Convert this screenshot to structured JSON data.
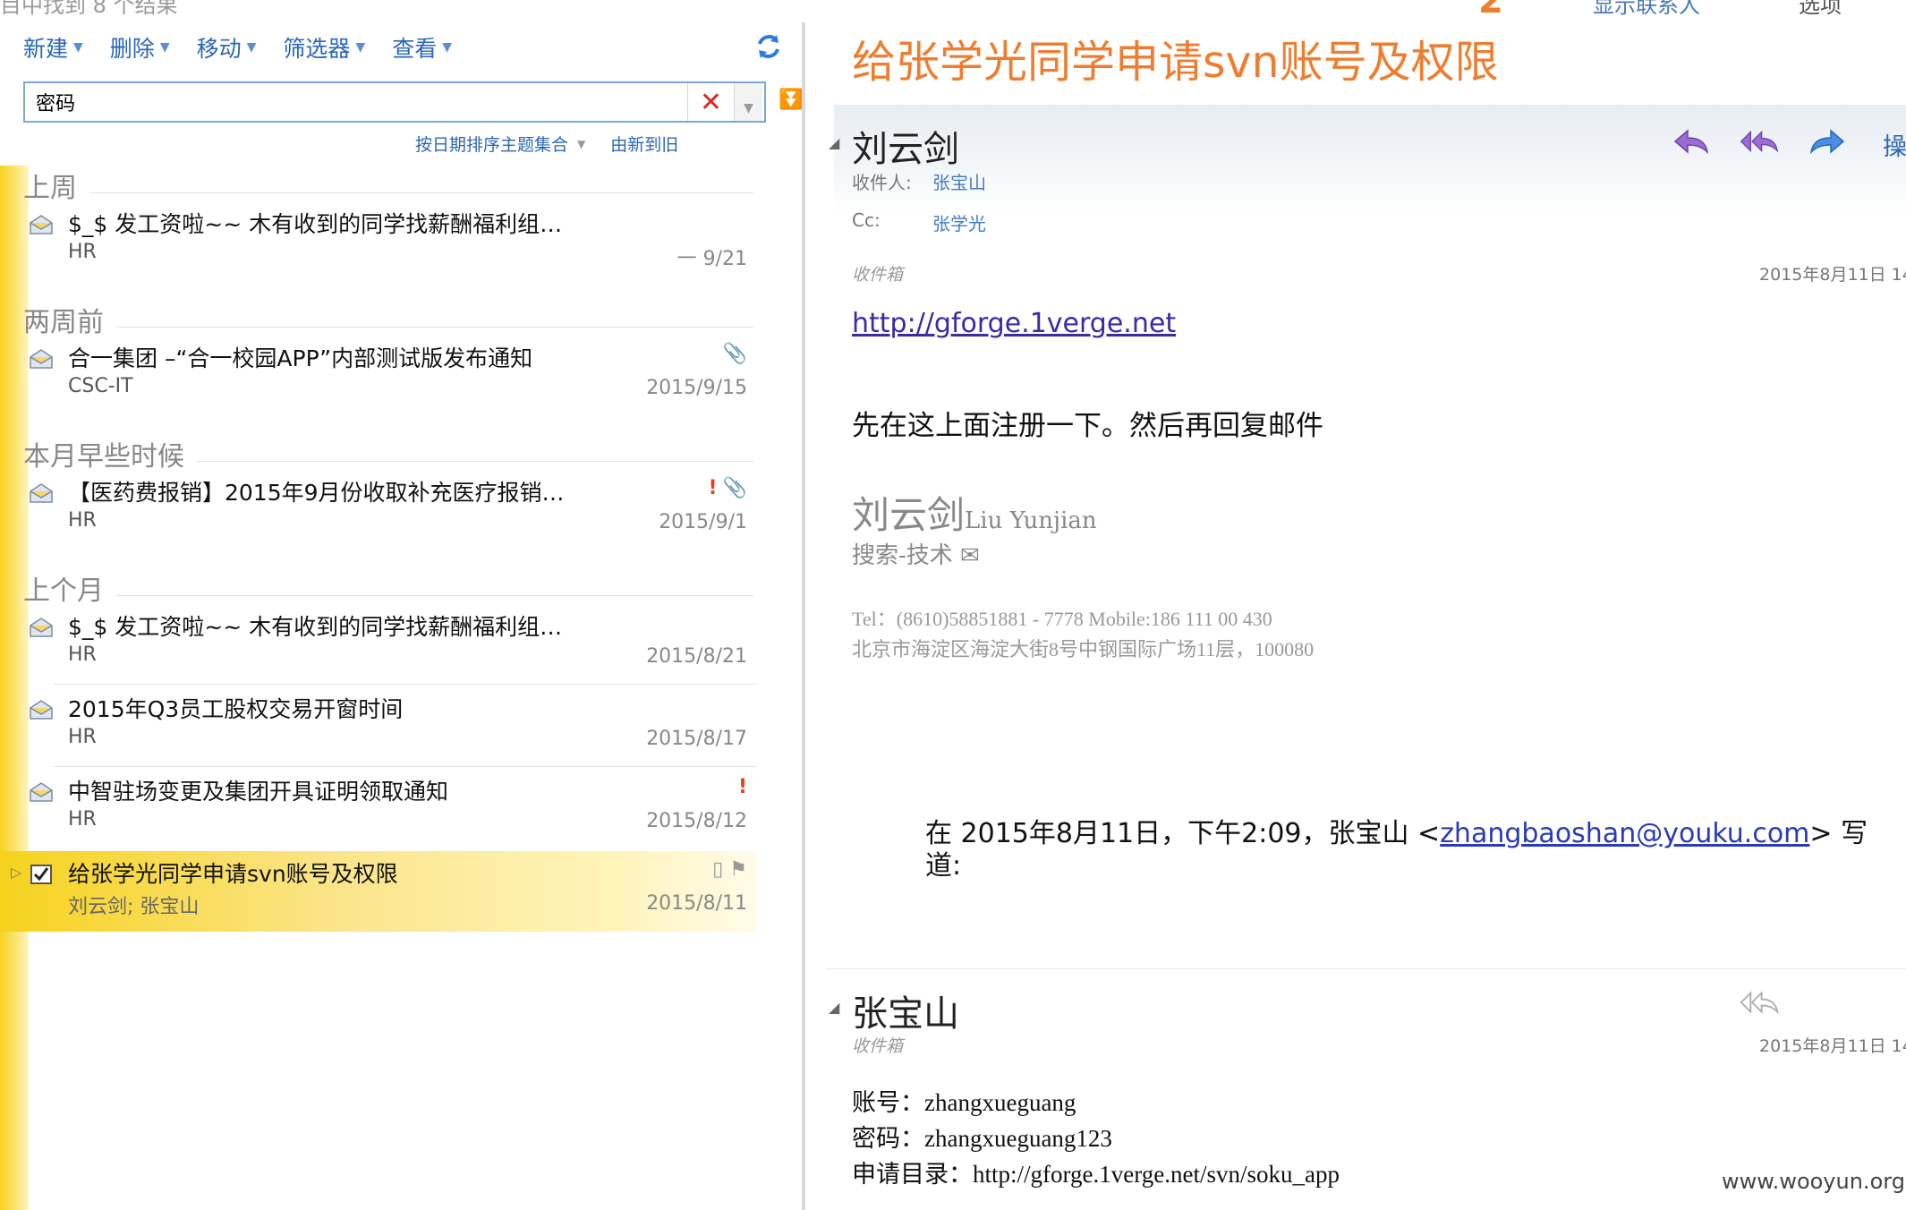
{
  "top_strip": {
    "left_cut_text": "目中找到 8 个结果",
    "badge_number": "2",
    "right_cut_1": "显示联系人",
    "right_cut_2": "选项"
  },
  "toolbar": {
    "new_label": "新建",
    "delete_label": "删除",
    "move_label": "移动",
    "filter_label": "筛选器",
    "view_label": "查看"
  },
  "search": {
    "value": "密码",
    "placeholder": ""
  },
  "sort": {
    "by_label": "按日期排序主题集合",
    "order_label": "由新到旧"
  },
  "groups": [
    {
      "label": "上周"
    },
    {
      "label": "两周前"
    },
    {
      "label": "本月早些时候"
    },
    {
      "label": "上个月"
    }
  ],
  "mails": [
    {
      "subject": "$_$ 发工资啦~~ 木有收到的同学找薪酬福利组…",
      "sender": "HR",
      "date": "一 9/21"
    },
    {
      "subject": "合一集团 –“合一校园APP”内部测试版发布通知",
      "sender": "CSC-IT",
      "date": "2015/9/15",
      "flags": "📎"
    },
    {
      "subject": "【医药费报销】2015年9月份收取补充医疗报销…",
      "sender": "HR",
      "date": "2015/9/1",
      "flags_imp": "!",
      "flags": "📎"
    },
    {
      "subject": "$_$ 发工资啦~~ 木有收到的同学找薪酬福利组…",
      "sender": "HR",
      "date": "2015/8/21"
    },
    {
      "subject": "2015年Q3员工股权交易开窗时间",
      "sender": "HR",
      "date": "2015/8/17"
    },
    {
      "subject": "中智驻场变更及集团开具证明领取通知",
      "sender": "HR",
      "date": "2015/8/12",
      "flags_imp": "!"
    },
    {
      "subject": "给张学光同学申请svn账号及权限",
      "sender": "刘云剑; 张宝山",
      "date": "2015/8/11",
      "flags": "▯ ⚑"
    }
  ],
  "reading": {
    "title": "给张学光同学申请svn账号及权限",
    "msg1": {
      "sender": "刘云剑",
      "to_label": "收件人:",
      "to": "张宝山",
      "cc_label": "Cc:",
      "cc": "张学光",
      "folder": "收件箱",
      "timestamp": "2015年8月11日 14",
      "op_label": "操",
      "link": "http://gforge.1verge.net",
      "body": "先在这上面注册一下。然后再回复邮件",
      "sig_name_cn": "刘云剑",
      "sig_name_en": "Liu Yunjian",
      "sig_dept": "搜索-技术 ✉",
      "sig_tel": "Tel：(8610)58851881 - 7778     Mobile:186 111 00 430",
      "sig_addr": "北京市海淀区海淀大街8号中钢国际广场11层，100080",
      "quote_prefix": "在 2015年8月11日，下午2:09，张宝山 <",
      "quote_email": "zhangbaoshan@youku.com",
      "quote_suffix": "> 写道:"
    },
    "msg2": {
      "sender": "张宝山",
      "folder": "收件箱",
      "timestamp": "2015年8月11日 14",
      "line1": "账号：zhangxueguang",
      "line2": "密码：zhangxueguang123",
      "line3": "申请目录：http://gforge.1verge.net/svn/soku_app"
    }
  },
  "watermark": "www.wooyun.org",
  "colors": {
    "title_orange": "#ef7d2f",
    "link_blue": "#2a66b8",
    "selection_yellow": "#f6d21d",
    "reply_purple": "#8a5cc8",
    "forward_blue": "#3f7cd8"
  }
}
